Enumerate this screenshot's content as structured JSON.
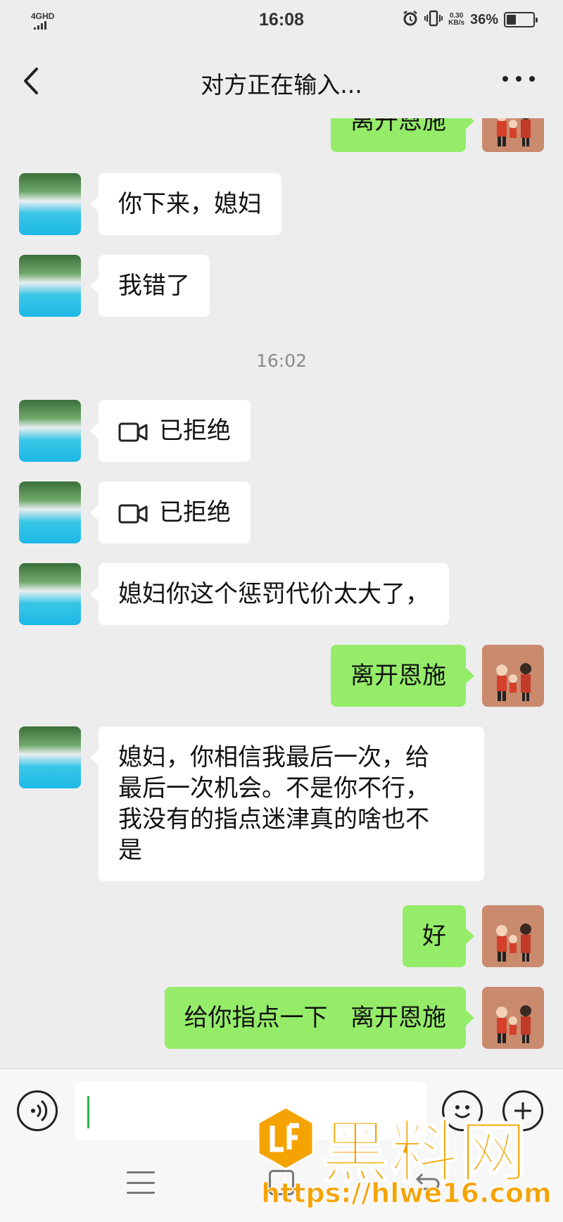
{
  "status_bar": {
    "network": "4GHD",
    "time": "16:08",
    "speed_value": "0.30",
    "speed_unit": "KB/s",
    "battery_percent": "36%",
    "battery_level": 0.36
  },
  "nav": {
    "title": "对方正在输入..."
  },
  "messages": [
    {
      "side": "right",
      "type": "text",
      "text": "离开恩施"
    },
    {
      "side": "left",
      "type": "text",
      "text": "你下来，媳妇"
    },
    {
      "side": "left",
      "type": "text",
      "text": "我错了"
    },
    {
      "type": "time",
      "text": "16:02"
    },
    {
      "side": "left",
      "type": "video-call",
      "text": "已拒绝"
    },
    {
      "side": "left",
      "type": "video-call",
      "text": "已拒绝"
    },
    {
      "side": "left",
      "type": "text",
      "text": "媳妇你这个惩罚代价太大了，"
    },
    {
      "side": "right",
      "type": "text",
      "text": "离开恩施"
    },
    {
      "side": "left",
      "type": "text",
      "lines": [
        "媳妇，你相信我最后一次，给",
        "最后一次机会。不是你不行，",
        "我没有的指点迷津真的啥也不",
        "是"
      ]
    },
    {
      "side": "right",
      "type": "text",
      "text": "好"
    },
    {
      "side": "right",
      "type": "text",
      "text": "给你指点一下   离开恩施"
    }
  ],
  "watermark": {
    "brand": "黑料网",
    "url": "https://hlwe16.com"
  },
  "colors": {
    "background": "#ededed",
    "my_bubble": "#95ec69",
    "peer_bubble": "#ffffff",
    "caret": "#2bb24c",
    "watermark": "#f5a300"
  }
}
